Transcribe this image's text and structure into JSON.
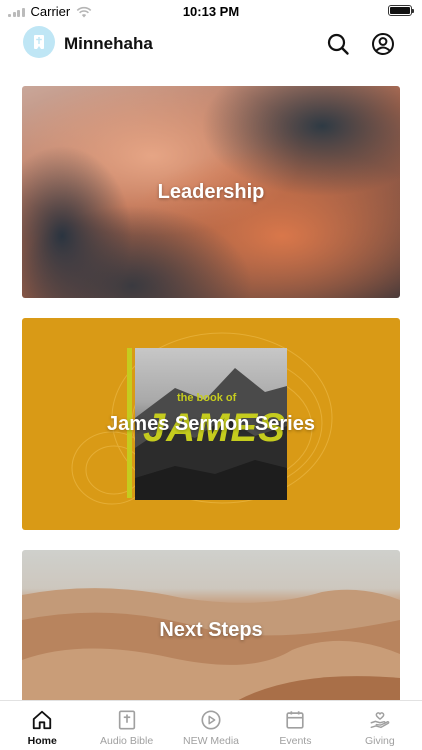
{
  "status_bar": {
    "carrier": "Carrier",
    "time": "10:13 PM"
  },
  "header": {
    "app_name": "Minnehaha"
  },
  "cards": [
    {
      "title": "Leadership"
    },
    {
      "title": "James Sermon Series",
      "art_subtitle": "the book of",
      "art_word": "JAMES"
    },
    {
      "title": "Next Steps"
    }
  ],
  "tabs": [
    {
      "label": "Home",
      "icon": "home-icon",
      "active": true
    },
    {
      "label": "Audio Bible",
      "icon": "bible-icon",
      "active": false
    },
    {
      "label": "NEW Media",
      "icon": "play-circle-icon",
      "active": false
    },
    {
      "label": "Events",
      "icon": "calendar-icon",
      "active": false
    },
    {
      "label": "Giving",
      "icon": "giving-hand-icon",
      "active": false
    }
  ],
  "colors": {
    "accent_card": "#d99a16",
    "art_highlight": "#c5cc1e",
    "logo_bg": "#bfe6f5",
    "tab_inactive": "#a0a0a0"
  }
}
